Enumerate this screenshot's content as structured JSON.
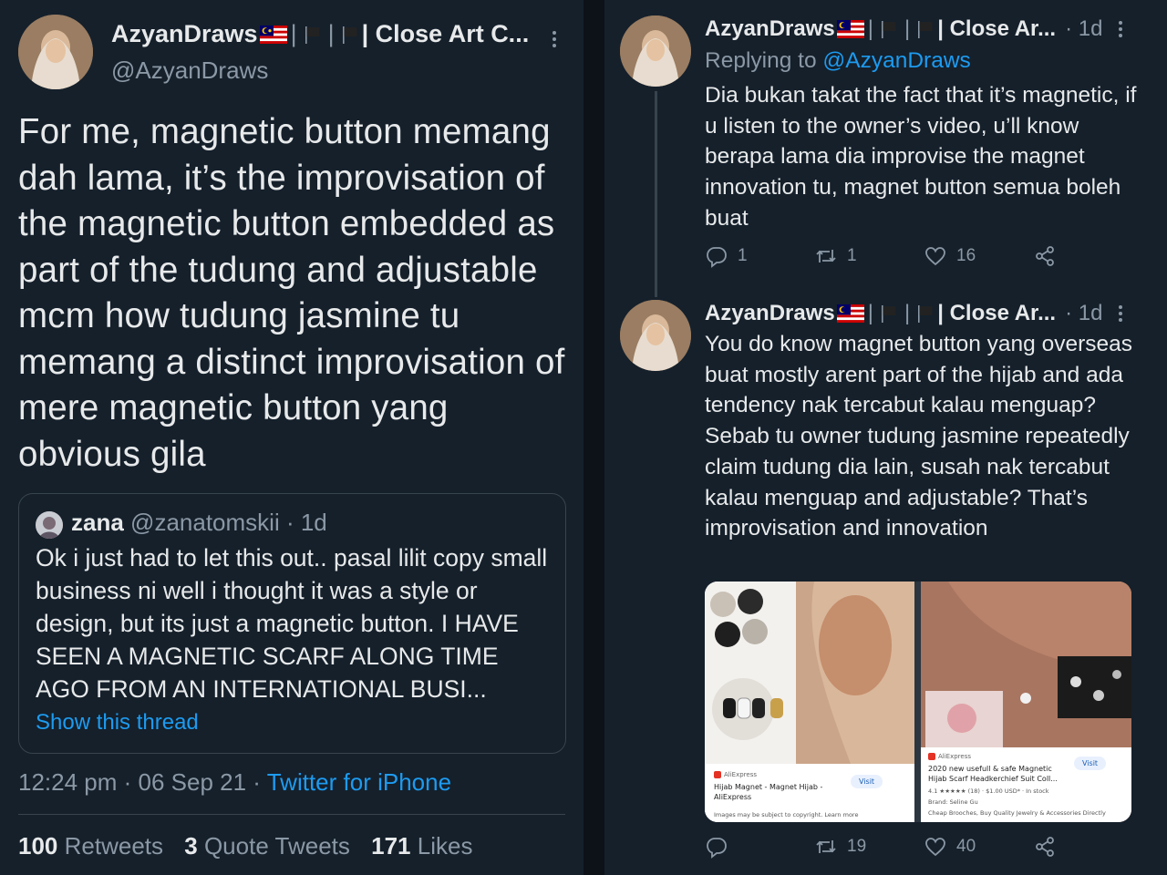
{
  "main_tweet": {
    "display_name": "AzyanDraws",
    "name_suffix": "| Close Art C...",
    "handle": "@AzyanDraws",
    "text": "For me, magnetic button memang dah lama, it’s the improvisation of the magnetic button embedded as part of the tudung and adjustable mcm how tudung jasmine tu memang a distinct improvisation of mere magnetic button yang obvious gila",
    "quoted": {
      "name": "zana",
      "handle": "@zanatomskii",
      "time": "· 1d",
      "text": "Ok i just had to let this out.. pasal lilit copy small business ni well i thought it was a style or design, but its just a magnetic button. I HAVE SEEN A MAGNETIC SCARF ALONG TIME AGO FROM AN INTERNATIONAL BUSI...",
      "show_thread": "Show this thread"
    },
    "time": "12:24 pm · 06 Sep 21 ·",
    "source": "Twitter for iPhone",
    "stats": {
      "retweets_count": "100",
      "retweets_label": "Retweets",
      "quotes_count": "3",
      "quotes_label": "Quote Tweets",
      "likes_count": "171",
      "likes_label": "Likes"
    }
  },
  "replies": [
    {
      "display_name": "AzyanDraws",
      "name_suffix": "| Close Ar...",
      "time": "· 1d",
      "replying_prefix": "Replying to",
      "replying_handle": "@AzyanDraws",
      "text": "Dia bukan takat the fact that it’s magnetic, if u listen to the owner’s video, u’ll know berapa lama dia improvise the magnet innovation tu, magnet button semua boleh buat",
      "reply_count": "1",
      "retweet_count": "1",
      "like_count": "16"
    },
    {
      "display_name": "AzyanDraws",
      "name_suffix": "| Close Ar...",
      "time": "· 1d",
      "text": "You do know magnet button yang overseas buat mostly arent part of the hijab and ada tendency nak tercabut kalau menguap? Sebab tu owner tudung jasmine repeatedly claim tudung dia lain, susah nak tercabut kalau menguap and adjustable? That’s improvisation and innovation",
      "reply_count": "",
      "retweet_count": "19",
      "like_count": "40",
      "media": [
        {
          "source": "AliExpress",
          "title": "Hijab Magnet - Magnet Hijab - AliExpress",
          "visit": "Visit",
          "note": "Images may be subject to copyright. Learn more"
        },
        {
          "source": "AliExpress",
          "title": "2020 new usefull & safe Magnetic Hijab Scarf Headkerchief Suit Coll...",
          "rating": "4.1 ★★★★★ (18) · $1.00 USD* · In stock",
          "brand": "Brand: Seline Gu",
          "footer": "Cheap Brooches, Buy Quality Jewelry & Accessories Directly",
          "visit": "Visit"
        }
      ]
    }
  ],
  "colors": {
    "background": "#15202b",
    "text": "#e7e9ea",
    "muted": "#8b98a5",
    "link": "#1d9bf0",
    "border": "#38444d"
  },
  "icons": [
    "more-icon",
    "reply-icon",
    "retweet-icon",
    "like-icon",
    "share-icon",
    "malaysia-flag-icon",
    "black-flag-icon"
  ]
}
